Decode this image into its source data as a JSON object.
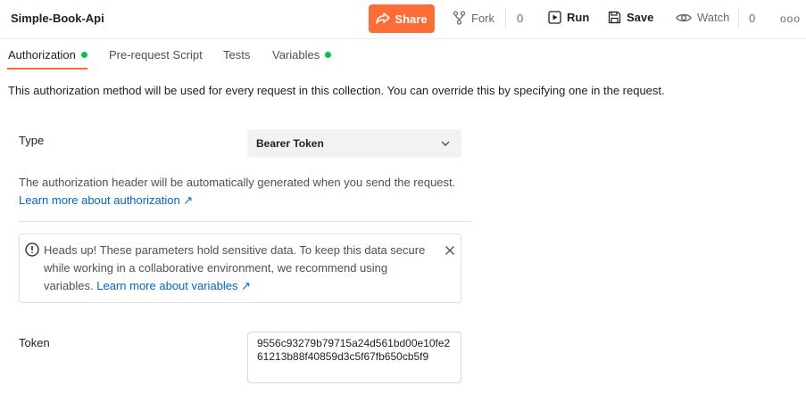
{
  "header": {
    "title": "Simple-Book-Api",
    "share_label": "Share",
    "fork_label": "Fork",
    "fork_count": "0",
    "run_label": "Run",
    "save_label": "Save",
    "watch_label": "Watch",
    "watch_count": "0",
    "more_label": "ooo"
  },
  "tabs": [
    {
      "label": "Authorization",
      "dot": true,
      "active": true
    },
    {
      "label": "Pre-request Script",
      "dot": false
    },
    {
      "label": "Tests",
      "dot": false
    },
    {
      "label": "Variables",
      "dot": true
    }
  ],
  "auth": {
    "description": "This authorization method will be used for every request in this collection. You can override this by specifying one in the request.",
    "type_label": "Type",
    "type_value": "Bearer Token",
    "header_info": "The authorization header will be automatically generated when you send the request.",
    "learn_more_auth": "Learn more about authorization ↗",
    "alert_text": "Heads up! These parameters hold sensitive data. To keep this data secure while working in a collaborative environment, we recommend using variables.",
    "learn_more_vars": "Learn more about variables ↗",
    "token_label": "Token",
    "token_value": "9556c93279b79715a24d561bd00e10fe261213b88f40859d3c5f67fb650cb5f9"
  },
  "colors": {
    "accent": "#ff6c37",
    "dot_green": "#0cbb52",
    "link": "#0265d2"
  }
}
